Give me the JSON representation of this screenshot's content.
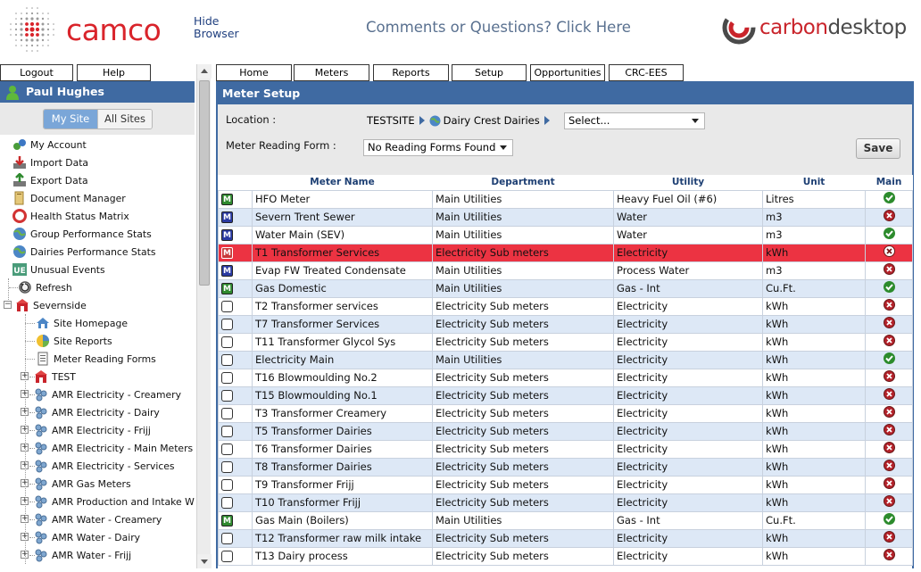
{
  "header": {
    "brand": "camco",
    "hide_browser_line1": "Hide",
    "hide_browser_line2": "Browser",
    "comments_link": "Comments or Questions? Click Here",
    "product_carbon": "carbon",
    "product_desktop": "desktop"
  },
  "left": {
    "tabs": [
      "Logout",
      "Help"
    ],
    "user_name": "Paul Hughes",
    "site_toggle": {
      "active": "My Site",
      "inactive": "All Sites"
    },
    "menu": [
      {
        "label": "My Account",
        "icon": "account-icon"
      },
      {
        "label": "Import Data",
        "icon": "import-icon"
      },
      {
        "label": "Export Data",
        "icon": "export-icon"
      },
      {
        "label": "Document Manager",
        "icon": "document-icon"
      },
      {
        "label": "Health Status Matrix",
        "icon": "health-icon"
      },
      {
        "label": "Group Performance Stats",
        "icon": "globe-icon"
      },
      {
        "label": "Dairies Performance Stats",
        "icon": "globe-icon"
      },
      {
        "label": "Unusual Events",
        "icon": "ue-icon"
      }
    ],
    "refresh": "Refresh",
    "site_root": "Severnside",
    "site_children": [
      "Site Homepage",
      "Site Reports",
      "Meter Reading Forms"
    ],
    "groups": [
      "TEST",
      "AMR Electricity - Creamery",
      "AMR Electricity - Dairy",
      "AMR Electricity - Frijj",
      "AMR Electricity - Main Meters",
      "AMR Electricity - Services",
      "AMR Gas Meters",
      "AMR Production and Intake WIP",
      "AMR Water - Creamery",
      "AMR Water - Dairy",
      "AMR Water - Frijj"
    ]
  },
  "main": {
    "tabs": [
      "Home",
      "Meters",
      "Reports",
      "Setup",
      "Opportunities",
      "CRC-EES"
    ],
    "title": "Meter Setup",
    "location_label": "Location :",
    "location_site": "TESTSITE",
    "location_sub": "Dairy Crest Dairies",
    "location_select": "Select...",
    "form_label": "Meter Reading Form :",
    "form_select": "No Reading Forms Found",
    "save": "Save",
    "columns": [
      "",
      "Meter Name",
      "Department",
      "Utility",
      "Unit",
      "Main"
    ],
    "rows": [
      {
        "badge": "M",
        "badge_color": "green",
        "name": "HFO Meter",
        "dept": "Main Utilities",
        "utility": "Heavy Fuel Oil (#6)",
        "unit": "Litres",
        "main": "yes"
      },
      {
        "badge": "M",
        "badge_color": "blue",
        "name": "Severn Trent Sewer",
        "dept": "Main Utilities",
        "utility": "Water",
        "unit": "m3",
        "main": "no"
      },
      {
        "badge": "M",
        "badge_color": "blue",
        "name": "Water Main (SEV)",
        "dept": "Main Utilities",
        "utility": "Water",
        "unit": "m3",
        "main": "yes"
      },
      {
        "badge": "M",
        "badge_color": "red",
        "name": "T1 Transformer Services",
        "dept": "Electricity Sub meters",
        "utility": "Electricity",
        "unit": "kWh",
        "main": "no",
        "highlight": true
      },
      {
        "badge": "M",
        "badge_color": "blue",
        "name": "Evap FW Treated Condensate",
        "dept": "Main Utilities",
        "utility": "Process Water",
        "unit": "m3",
        "main": "no"
      },
      {
        "badge": "M",
        "badge_color": "green",
        "name": "Gas Domestic",
        "dept": "Main Utilities",
        "utility": "Gas - Int",
        "unit": "Cu.Ft.",
        "main": "yes"
      },
      {
        "badge": "",
        "badge_color": "empty",
        "name": "T2 Transformer services",
        "dept": "Electricity Sub meters",
        "utility": "Electricity",
        "unit": "kWh",
        "main": "no"
      },
      {
        "badge": "",
        "badge_color": "empty",
        "name": "T7 Transformer Services",
        "dept": "Electricity Sub meters",
        "utility": "Electricity",
        "unit": "kWh",
        "main": "no"
      },
      {
        "badge": "",
        "badge_color": "empty",
        "name": "T11 Transformer Glycol Sys",
        "dept": "Electricity Sub meters",
        "utility": "Electricity",
        "unit": "kWh",
        "main": "no"
      },
      {
        "badge": "",
        "badge_color": "empty",
        "name": "Electricity Main",
        "dept": "Main Utilities",
        "utility": "Electricity",
        "unit": "kWh",
        "main": "yes"
      },
      {
        "badge": "",
        "badge_color": "empty",
        "name": "T16 Blowmoulding No.2",
        "dept": "Electricity Sub meters",
        "utility": "Electricity",
        "unit": "kWh",
        "main": "no"
      },
      {
        "badge": "",
        "badge_color": "empty",
        "name": "T15 Blowmoulding No.1",
        "dept": "Electricity Sub meters",
        "utility": "Electricity",
        "unit": "kWh",
        "main": "no"
      },
      {
        "badge": "",
        "badge_color": "empty",
        "name": "T3 Transformer Creamery",
        "dept": "Electricity Sub meters",
        "utility": "Electricity",
        "unit": "kWh",
        "main": "no"
      },
      {
        "badge": "",
        "badge_color": "empty",
        "name": "T5 Transformer Dairies",
        "dept": "Electricity Sub meters",
        "utility": "Electricity",
        "unit": "kWh",
        "main": "no"
      },
      {
        "badge": "",
        "badge_color": "empty",
        "name": "T6 Transformer Dairies",
        "dept": "Electricity Sub meters",
        "utility": "Electricity",
        "unit": "kWh",
        "main": "no"
      },
      {
        "badge": "",
        "badge_color": "empty",
        "name": "T8 Transformer Dairies",
        "dept": "Electricity Sub meters",
        "utility": "Electricity",
        "unit": "kWh",
        "main": "no"
      },
      {
        "badge": "",
        "badge_color": "empty",
        "name": "T9 Transformer Frijj",
        "dept": "Electricity Sub meters",
        "utility": "Electricity",
        "unit": "kWh",
        "main": "no"
      },
      {
        "badge": "",
        "badge_color": "empty",
        "name": "T10 Transformer Frijj",
        "dept": "Electricity Sub meters",
        "utility": "Electricity",
        "unit": "kWh",
        "main": "no"
      },
      {
        "badge": "M",
        "badge_color": "green",
        "name": "Gas Main (Boilers)",
        "dept": "Main Utilities",
        "utility": "Gas - Int",
        "unit": "Cu.Ft.",
        "main": "yes"
      },
      {
        "badge": "",
        "badge_color": "empty",
        "name": "T12 Transformer raw milk intake",
        "dept": "Electricity Sub meters",
        "utility": "Electricity",
        "unit": "kWh",
        "main": "no"
      },
      {
        "badge": "",
        "badge_color": "empty",
        "name": "T13 Dairy process",
        "dept": "Electricity Sub meters",
        "utility": "Electricity",
        "unit": "kWh",
        "main": "no"
      }
    ]
  },
  "colors": {
    "brand_red": "#d9242b",
    "panel_blue": "#3f6aa2",
    "row_alt": "#dde8f6",
    "row_highlight": "#ec3342",
    "ok_green": "#2c8b2c",
    "no_red": "#b3222a"
  }
}
